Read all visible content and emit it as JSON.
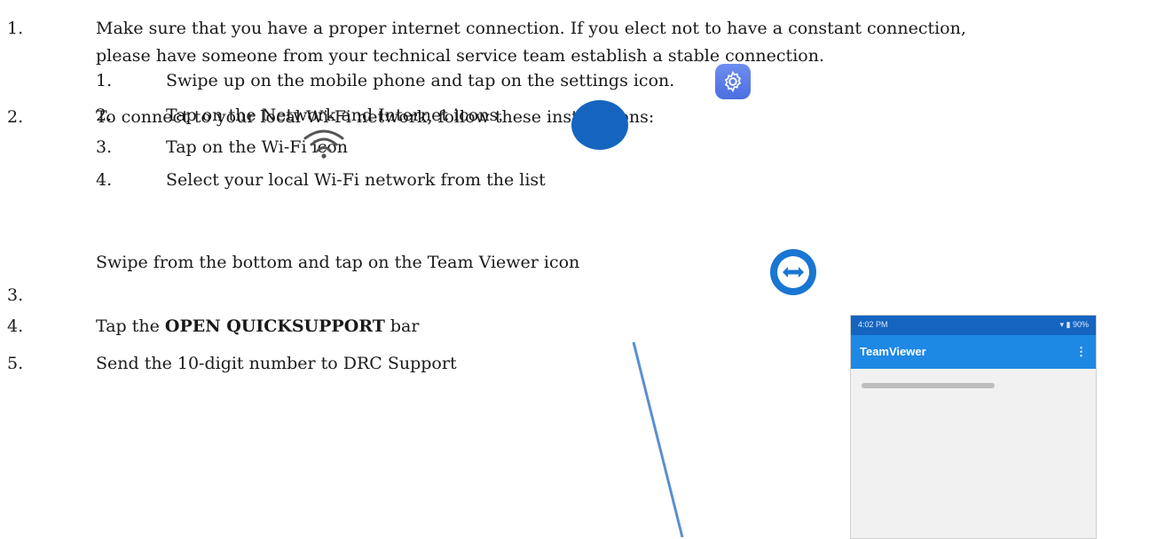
{
  "steps": [
    {
      "number": "1.",
      "line1": "Make sure that you have a proper internet connection. If you elect not to have a constant connection,",
      "line2": "please have someone from your technical service team establish a stable connection."
    },
    {
      "number": "2.",
      "text": "To connect to your local Wi-Fi network, follow these instructions:",
      "substeps": [
        {
          "number": "1.",
          "text": "Swipe up on the mobile phone and tap on the settings icon."
        },
        {
          "number": "2.",
          "text": "Tap on the Network and Internet icons."
        },
        {
          "number": "3.",
          "text": "Tap on the Wi-Fi icon"
        },
        {
          "number": "4.",
          "text": "Select your local Wi-Fi network from the list"
        }
      ]
    },
    {
      "number": "3.",
      "text": "Swipe from the bottom and tap on the Team Viewer icon"
    },
    {
      "number": "4.",
      "text_before": "Tap the ",
      "bold": "OPEN QUICKSUPPORT",
      "text_after": " bar"
    },
    {
      "number": "5.",
      "text": "Send the 10-digit number to DRC Support"
    }
  ],
  "phone": {
    "status_time": "4:02 PM",
    "status_right": "▾ ▮ 90%",
    "app_title": "TeamViewer",
    "menu_glyph": "⋮"
  },
  "colors": {
    "settings_icon": "#5b7ce8",
    "network_icon": "#1565c0",
    "teamviewer_icon": "#1976d2",
    "arrow": "#5a8fd0"
  },
  "icons": [
    "gear-icon",
    "network-icon",
    "wifi-icon",
    "teamviewer-icon",
    "arrow-line"
  ]
}
